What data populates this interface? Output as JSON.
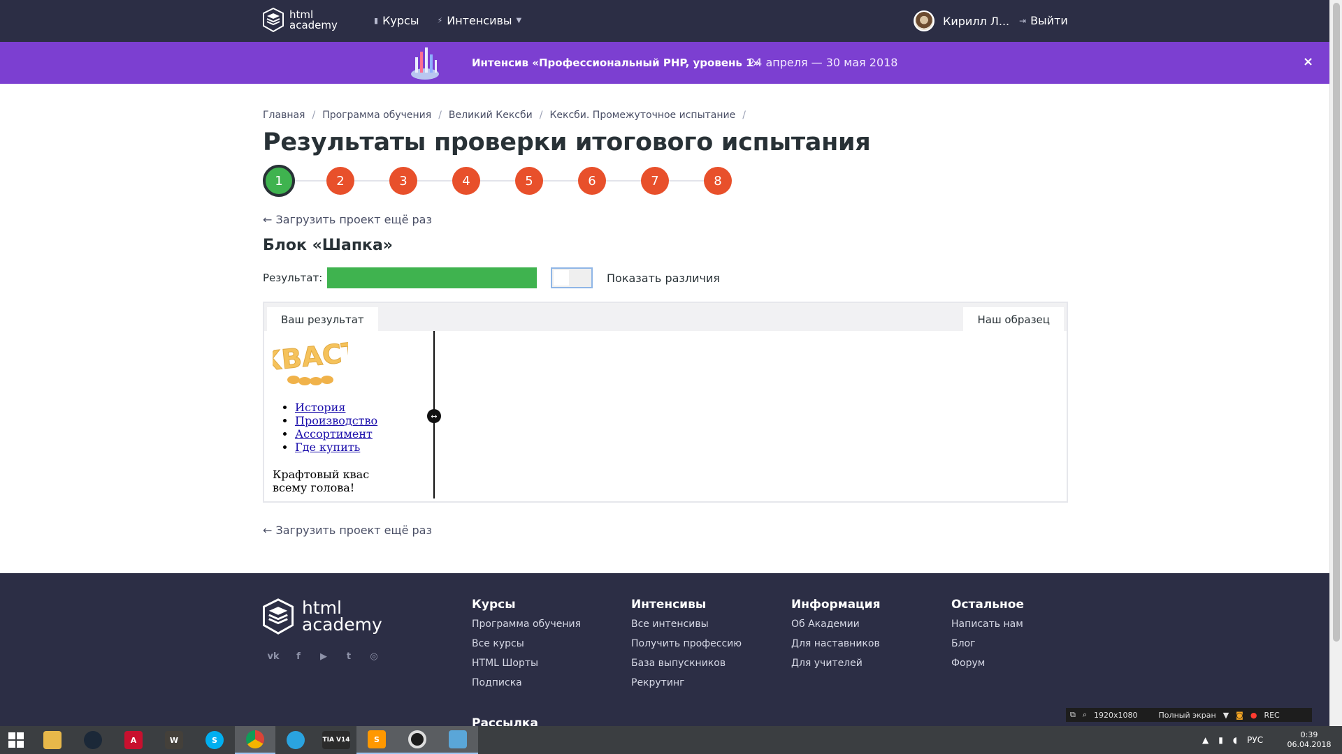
{
  "header": {
    "logo": [
      "html",
      "academy"
    ],
    "nav": [
      {
        "label": "Курсы",
        "icon": "bars-icon"
      },
      {
        "label": "Интенсивы",
        "icon": "lightning-icon"
      }
    ],
    "user_name": "Кирилл Л...",
    "logout_label": "Выйти"
  },
  "promo": {
    "title": "Интенсив «Профессиональный PHP, уровень 1»",
    "dates": "24 апреля — 30 мая 2018",
    "close_label": "×",
    "color": "#7c3fd1"
  },
  "breadcrumb": [
    "Главная",
    "Программа обучения",
    "Великий Кексби",
    "Кексби. Промежуточное испытание"
  ],
  "breadcrumb_sep": "/",
  "page_title": "Результаты проверки итогового испытания",
  "steps": [
    "1",
    "2",
    "3",
    "4",
    "5",
    "6",
    "7",
    "8"
  ],
  "active_step": "1",
  "reload_label": "← Загрузить проект ещё раз",
  "block_title": "Блок «Шапка»",
  "result": {
    "label": "Результат:",
    "score_fraction": 1.0,
    "show_diff_label": "Показать различия",
    "success_color": "#3fb34f"
  },
  "compare": {
    "tab_yours": "Ваш результат",
    "tab_ours": "Наш образец",
    "logo_text": "КВАСТ",
    "nav_items": [
      "История",
      "Производство",
      "Ассортимент",
      "Где купить"
    ],
    "tagline": "Крафтовый квас всему голова!",
    "handle_glyph": "↔"
  },
  "footer": {
    "logo": [
      "html",
      "academy"
    ],
    "social": [
      "vk-icon",
      "facebook-icon",
      "youtube-icon",
      "twitter-icon",
      "instagram-icon"
    ],
    "columns": [
      {
        "title": "Курсы",
        "links": [
          "Программа обучения",
          "Все курсы",
          "HTML Шорты",
          "Подписка"
        ]
      },
      {
        "title": "Интенсивы",
        "links": [
          "Все интенсивы",
          "Получить профессию",
          "База выпускников",
          "Рекрутинг"
        ]
      },
      {
        "title": "Информация",
        "links": [
          "Об Академии",
          "Для наставников",
          "Для учителей"
        ]
      },
      {
        "title": "Остальное",
        "links": [
          "Написать нам",
          "Блог",
          "Форум"
        ]
      }
    ],
    "newsletter": "Рассылка"
  },
  "recorder": {
    "resolution": "1920x1080",
    "mode": "Полный экран",
    "rec_label": "REC"
  },
  "taskbar": {
    "apps": [
      {
        "name": "file-explorer",
        "glyph": "",
        "color": "#e8b84a"
      },
      {
        "name": "steam",
        "glyph": "",
        "color": "#1b2838"
      },
      {
        "name": "autocad",
        "glyph": "A",
        "color": "#c8102e"
      },
      {
        "name": "world-of-tanks",
        "glyph": "W",
        "color": "#44403a"
      },
      {
        "name": "skype",
        "glyph": "S",
        "color": "#00aff0"
      },
      {
        "name": "chrome",
        "glyph": "",
        "color": "#4285f4"
      },
      {
        "name": "telegram",
        "glyph": "",
        "color": "#2aa3df"
      },
      {
        "name": "tia-portal",
        "glyph": "TIA V14",
        "color": "#2b2b2b"
      },
      {
        "name": "sublime-text",
        "glyph": "S",
        "color": "#ff9800"
      },
      {
        "name": "recorder",
        "glyph": "",
        "color": "#1b1b1b"
      },
      {
        "name": "image-viewer",
        "glyph": "",
        "color": "#5aa6d8"
      }
    ],
    "active_app": "chrome",
    "language": "РУС",
    "time": "0:39",
    "date": "06.04.2018"
  }
}
